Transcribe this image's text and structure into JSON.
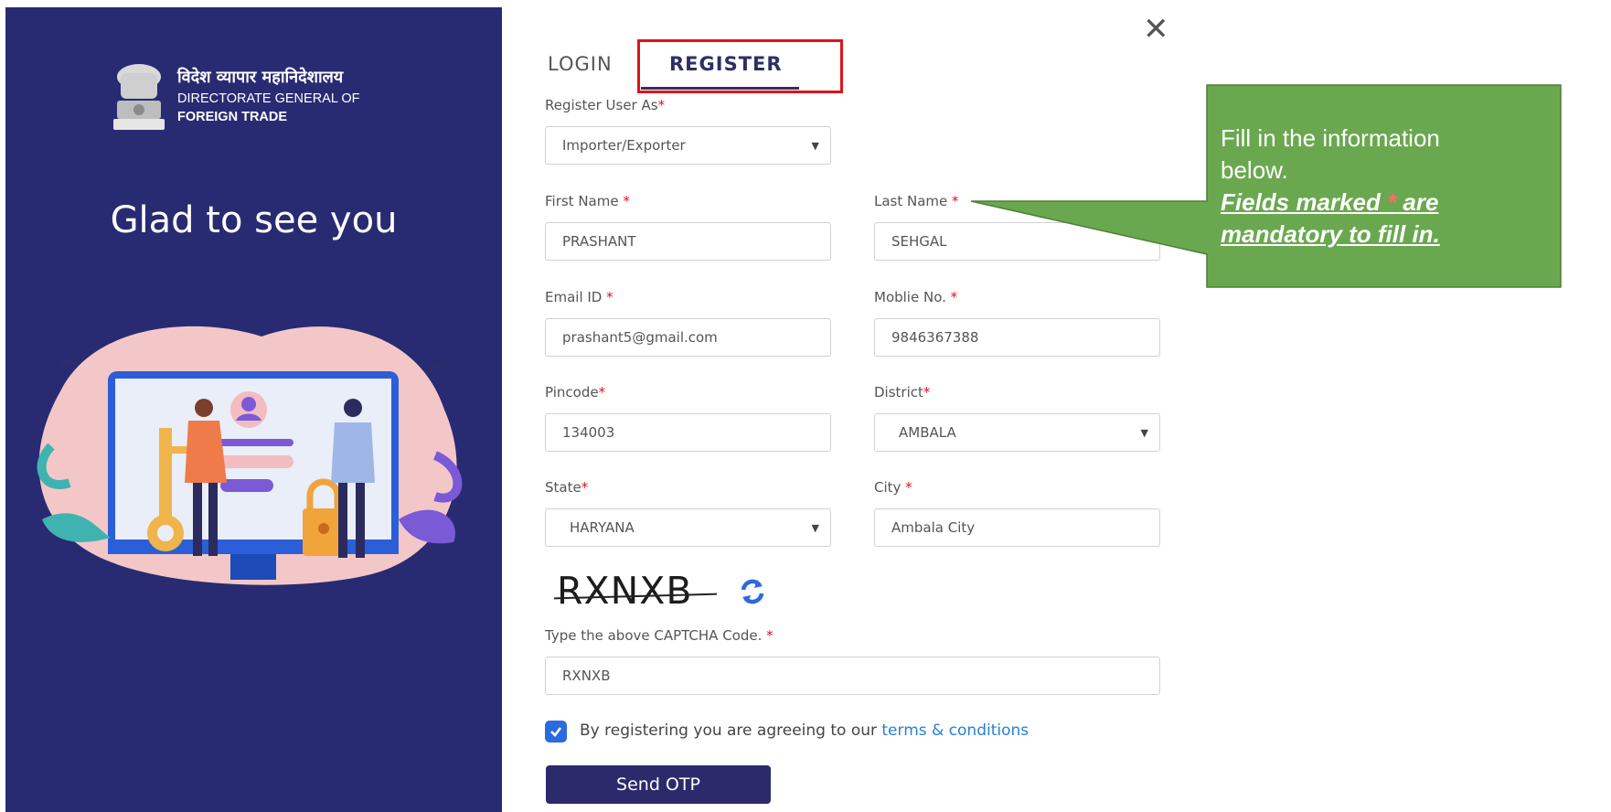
{
  "branding": {
    "org_hindi": "विदेश व्यापार महानिदेशालय",
    "org_english_line1": "DIRECTORATE GENERAL OF",
    "org_english_line2": "FOREIGN TRADE",
    "greeting": "Glad to see you"
  },
  "tabs": {
    "login": "LOGIN",
    "register": "REGISTER",
    "active": "REGISTER"
  },
  "form": {
    "register_as": {
      "label": "Register User As",
      "value": "Importer/Exporter"
    },
    "first_name": {
      "label": "First Name ",
      "value": "PRASHANT"
    },
    "last_name": {
      "label": "Last Name ",
      "value": "SEHGAL"
    },
    "email": {
      "label": "Email ID ",
      "value": "prashant5@gmail.com"
    },
    "mobile": {
      "label": "Moblie No. ",
      "value": "9846367388"
    },
    "pincode": {
      "label": "Pincode",
      "value": "134003"
    },
    "district": {
      "label": "District",
      "value": "AMBALA"
    },
    "state": {
      "label": "State",
      "value": "HARYANA"
    },
    "city": {
      "label": "City ",
      "value": "Ambala City"
    },
    "captcha_image_text": "RXNXB",
    "captcha": {
      "label": "Type the above CAPTCHA Code. ",
      "value": "RXNXB"
    },
    "required_mark": "*",
    "agree_text": "By registering you are agreeing to our ",
    "terms_link": "terms & conditions",
    "agree_checked": true,
    "send_otp": "Send OTP"
  },
  "close_symbol": "✕",
  "callout": {
    "line1": "Fill in the information below.",
    "line2_a": "Fields marked ",
    "line2_star": "*",
    "line2_b": " are mandatory to fill in."
  },
  "colors": {
    "left_panel": "#282b72",
    "primary": "#2d2a6b",
    "required": "#e0121b",
    "link": "#2a7fd4",
    "callout_fill": "#6aa84f",
    "highlight_border": "#e0121b"
  },
  "icons": [
    "emblem-icon",
    "close-icon",
    "chevron-down-icon",
    "refresh-icon",
    "check-icon"
  ]
}
